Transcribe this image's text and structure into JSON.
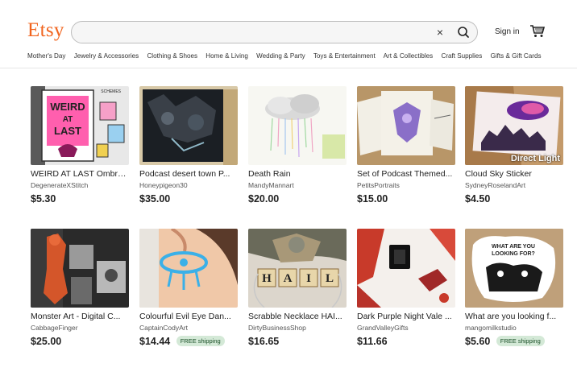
{
  "header": {
    "logo": "Etsy",
    "search_value": "",
    "clear_label": "×",
    "sign_in": "Sign in"
  },
  "nav": [
    "Mother's Day",
    "Jewelry & Accessories",
    "Clothing & Shoes",
    "Home & Living",
    "Wedding & Party",
    "Toys & Entertainment",
    "Art & Collectibles",
    "Craft Supplies",
    "Gifts & Gift Cards"
  ],
  "listings": [
    {
      "title": "WEIRD AT LAST Ombre...",
      "shop": "DegenerateXStitch",
      "price": "$5.30",
      "thumb_text_1": "WEIRD",
      "thumb_text_2": "AT",
      "thumb_text_3": "LAST",
      "thumb_text_4": "SCHEMES"
    },
    {
      "title": "Podcast desert town P...",
      "shop": "Honeypigeon30",
      "price": "$35.00"
    },
    {
      "title": "Death Rain",
      "shop": "MandyMannart",
      "price": "$20.00"
    },
    {
      "title": "Set of Podcast Themed...",
      "shop": "PetitsPortraits",
      "price": "$15.00"
    },
    {
      "title": "Cloud Sky Sticker",
      "shop": "SydneyRoselandArt",
      "price": "$4.50",
      "overlay": "Direct Light"
    },
    {
      "title": "Monster Art - Digital C...",
      "shop": "CabbageFinger",
      "price": "$25.00"
    },
    {
      "title": "Colourful Evil Eye Dan...",
      "shop": "CaptainCodyArt",
      "price": "$14.44",
      "badge": "FREE shipping"
    },
    {
      "title": "Scrabble Necklace HAI...",
      "shop": "DirtyBusinessShop",
      "price": "$16.65",
      "tiles": [
        "H",
        "A",
        "I",
        "L"
      ]
    },
    {
      "title": "Dark Purple Night Vale ...",
      "shop": "GrandValleyGifts",
      "price": "$11.66"
    },
    {
      "title": "What are you looking f...",
      "shop": "mangomilkstudio",
      "price": "$5.60",
      "badge": "FREE shipping",
      "thumb_text_1": "WHAT ARE YOU",
      "thumb_text_2": "LOOKING FOR?"
    }
  ],
  "colors": {
    "brand": "#f1641e",
    "badge_bg": "#d4e9d7",
    "badge_text": "#1a4f27"
  },
  "icons": {
    "search": "magnifier-icon",
    "clear": "close-icon",
    "cart": "cart-icon"
  }
}
